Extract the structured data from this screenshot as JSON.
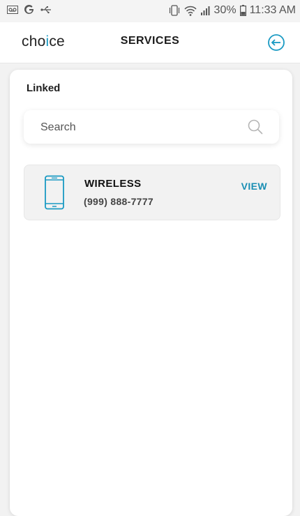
{
  "status_bar": {
    "battery": "30%",
    "time": "11:33 AM",
    "left_icons": [
      "voicemail-icon",
      "google-icon",
      "usb-icon"
    ],
    "right_icons": [
      "vibrate-icon",
      "wifi-icon",
      "signal-icon",
      "battery-icon"
    ]
  },
  "header": {
    "logo_prefix": "cho",
    "logo_dot": "i",
    "logo_suffix": "ce",
    "title": "SERVICES",
    "back_icon": "back-arrow-icon"
  },
  "colors": {
    "accent": "#1a9ac3",
    "link": "#1a8fb4"
  },
  "linked": {
    "heading": "Linked",
    "search": {
      "placeholder": "Search",
      "value": ""
    },
    "services": [
      {
        "icon": "smartphone-icon",
        "name": "WIRELESS",
        "number": "(999) 888-7777",
        "action": "VIEW"
      }
    ]
  }
}
